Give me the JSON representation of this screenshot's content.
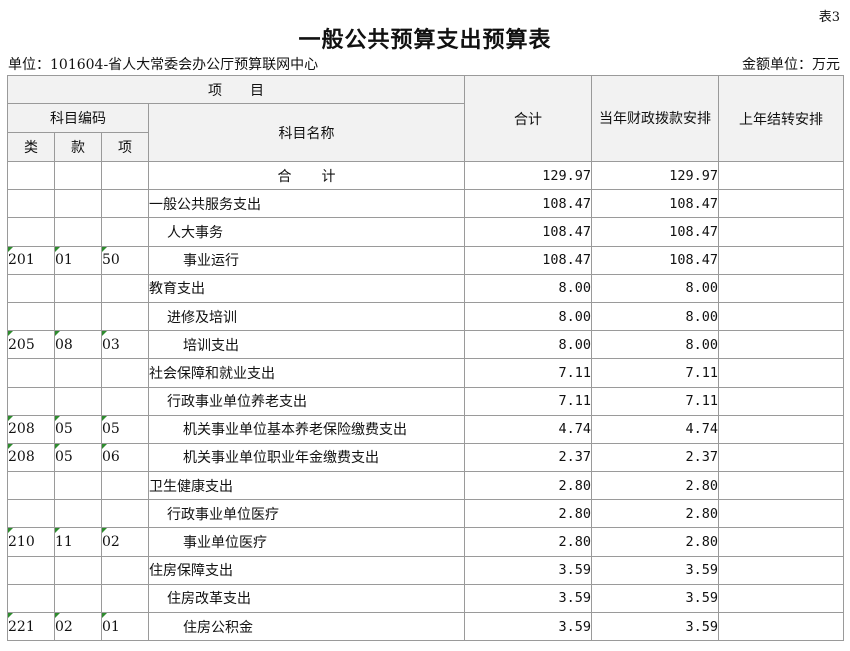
{
  "table_no": "表3",
  "title": "一般公共预算支出预算表",
  "unit": "单位：101604-省人大常委会办公厅预算联网中心",
  "amount_unit": "金额单位：万元",
  "headers": {
    "item": "项　　目",
    "code": "科目编码",
    "lei": "类",
    "kuan": "款",
    "xiang": "项",
    "name": "科目名称",
    "total": "合计",
    "current": "当年财政拨款安排",
    "carryover": "上年结转安排"
  },
  "rows": [
    {
      "lei": "",
      "kuan": "",
      "xiang": "",
      "name": "合计",
      "total": "129.97",
      "current": "129.97",
      "carryover": "",
      "level": "total"
    },
    {
      "lei": "",
      "kuan": "",
      "xiang": "",
      "name": "一般公共服务支出",
      "total": "108.47",
      "current": "108.47",
      "carryover": "",
      "level": "0"
    },
    {
      "lei": "",
      "kuan": "",
      "xiang": "",
      "name": "人大事务",
      "total": "108.47",
      "current": "108.47",
      "carryover": "",
      "level": "1"
    },
    {
      "lei": "201",
      "kuan": "01",
      "xiang": "50",
      "name": "事业运行",
      "total": "108.47",
      "current": "108.47",
      "carryover": "",
      "level": "2"
    },
    {
      "lei": "",
      "kuan": "",
      "xiang": "",
      "name": "教育支出",
      "total": "8.00",
      "current": "8.00",
      "carryover": "",
      "level": "0"
    },
    {
      "lei": "",
      "kuan": "",
      "xiang": "",
      "name": "进修及培训",
      "total": "8.00",
      "current": "8.00",
      "carryover": "",
      "level": "1"
    },
    {
      "lei": "205",
      "kuan": "08",
      "xiang": "03",
      "name": "培训支出",
      "total": "8.00",
      "current": "8.00",
      "carryover": "",
      "level": "2"
    },
    {
      "lei": "",
      "kuan": "",
      "xiang": "",
      "name": "社会保障和就业支出",
      "total": "7.11",
      "current": "7.11",
      "carryover": "",
      "level": "0"
    },
    {
      "lei": "",
      "kuan": "",
      "xiang": "",
      "name": "行政事业单位养老支出",
      "total": "7.11",
      "current": "7.11",
      "carryover": "",
      "level": "1"
    },
    {
      "lei": "208",
      "kuan": "05",
      "xiang": "05",
      "name": "机关事业单位基本养老保险缴费支出",
      "total": "4.74",
      "current": "4.74",
      "carryover": "",
      "level": "2"
    },
    {
      "lei": "208",
      "kuan": "05",
      "xiang": "06",
      "name": "机关事业单位职业年金缴费支出",
      "total": "2.37",
      "current": "2.37",
      "carryover": "",
      "level": "2"
    },
    {
      "lei": "",
      "kuan": "",
      "xiang": "",
      "name": "卫生健康支出",
      "total": "2.80",
      "current": "2.80",
      "carryover": "",
      "level": "0"
    },
    {
      "lei": "",
      "kuan": "",
      "xiang": "",
      "name": "行政事业单位医疗",
      "total": "2.80",
      "current": "2.80",
      "carryover": "",
      "level": "1"
    },
    {
      "lei": "210",
      "kuan": "11",
      "xiang": "02",
      "name": "事业单位医疗",
      "total": "2.80",
      "current": "2.80",
      "carryover": "",
      "level": "2"
    },
    {
      "lei": "",
      "kuan": "",
      "xiang": "",
      "name": "住房保障支出",
      "total": "3.59",
      "current": "3.59",
      "carryover": "",
      "level": "0"
    },
    {
      "lei": "",
      "kuan": "",
      "xiang": "",
      "name": "住房改革支出",
      "total": "3.59",
      "current": "3.59",
      "carryover": "",
      "level": "1"
    },
    {
      "lei": "221",
      "kuan": "02",
      "xiang": "01",
      "name": "住房公积金",
      "total": "3.59",
      "current": "3.59",
      "carryover": "",
      "level": "2"
    }
  ]
}
